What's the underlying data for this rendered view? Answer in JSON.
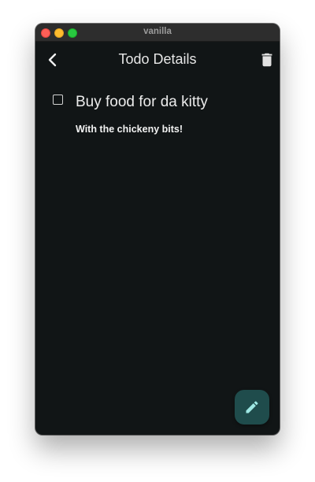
{
  "window": {
    "title": "vanilla"
  },
  "appbar": {
    "title": "Todo Details",
    "back_icon": "chevron-left-icon",
    "delete_icon": "trash-icon"
  },
  "todo": {
    "completed": false,
    "title": "Buy food for da kitty",
    "description": "With the chickeny bits!"
  },
  "fab": {
    "icon": "pencil-icon"
  },
  "colors": {
    "background": "#111516",
    "fab_background": "#1f4c4c",
    "fab_icon": "#9ee8e4",
    "text": "#ececec"
  }
}
